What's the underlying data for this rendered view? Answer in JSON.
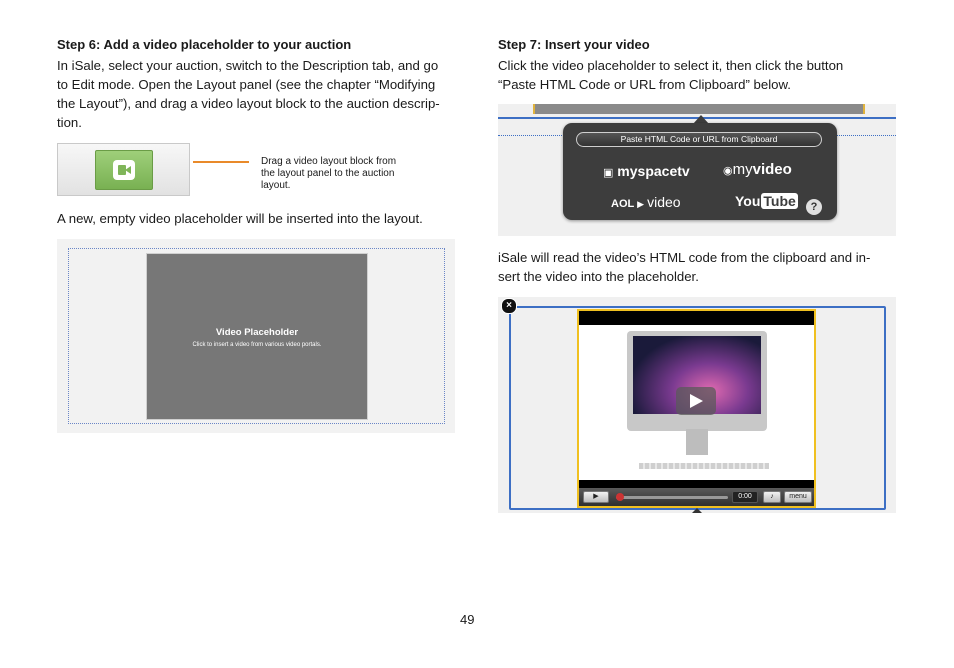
{
  "left": {
    "step6_heading": "Step 6: Add a video placeholder to your auction",
    "step6_lines": [
      "In iSale, select your auction, switch to the Description tab, and go",
      "to Edit mode. Open the Layout panel (see the chapter “Modifying",
      "the Layout”), and drag a video layout block to the auction descrip-",
      "tion."
    ],
    "callout_lines": [
      "Drag a video layout block from",
      "the layout panel to the auction",
      "layout."
    ],
    "after_text": "A new, empty video placeholder will be inserted into the layout.",
    "placeholder_title": "Video Placeholder",
    "placeholder_sub": "Click to insert a video from various video portals."
  },
  "right": {
    "step7_heading": "Step 7: Insert your video",
    "step7_lines": [
      "Click the video placeholder to select it, then click the button",
      "“Paste HTML Code or URL from Clipboard” below."
    ],
    "paste_button": "Paste HTML Code or URL from Clipboard",
    "logos": {
      "myspacetv": "myspacetv",
      "myvideo_my": "my",
      "myvideo_video": "video",
      "aol": "AOL",
      "aol_video": "video",
      "you": "You",
      "tube": "Tube"
    },
    "help": "?",
    "after_lines": [
      "iSale will read the video’s HTML code from the clipboard and in-",
      "sert the video into the placeholder."
    ],
    "video_time": "0:00",
    "video_menu": "menu",
    "watermark": "YouTube",
    "close": "×"
  },
  "page_number": "49",
  "colors": {
    "accent_blue": "#3d6fc4",
    "callout_orange": "#e98a2a",
    "selection_yellow": "#f0c020"
  },
  "icons": [
    "video-camera-icon",
    "play-icon",
    "close-icon",
    "help-icon",
    "volume-icon"
  ]
}
